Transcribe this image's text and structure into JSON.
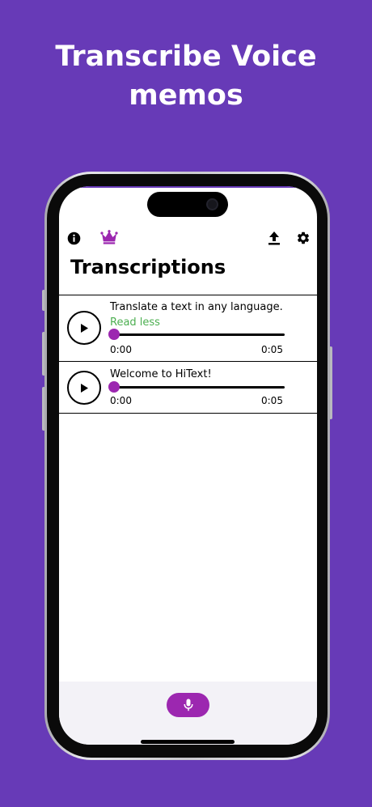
{
  "headline": {
    "line1": "Transcribe Voice",
    "line2": "memos"
  },
  "header": {
    "title": "Transcriptions",
    "icons": [
      "info-icon",
      "crown-icon",
      "upload-icon",
      "gear-icon"
    ]
  },
  "transcriptions": [
    {
      "text": "Translate a text in any language.",
      "toggle_label": "Read less",
      "current_time": "0:00",
      "duration": "0:05",
      "progress": 0
    },
    {
      "text": "Welcome to HiText!",
      "current_time": "0:00",
      "duration": "0:05",
      "progress": 0
    }
  ],
  "colors": {
    "background": "#673ab7",
    "accent": "#9c27b0",
    "link": "#4caf50",
    "bottom_bar": "#f3f2f7"
  }
}
